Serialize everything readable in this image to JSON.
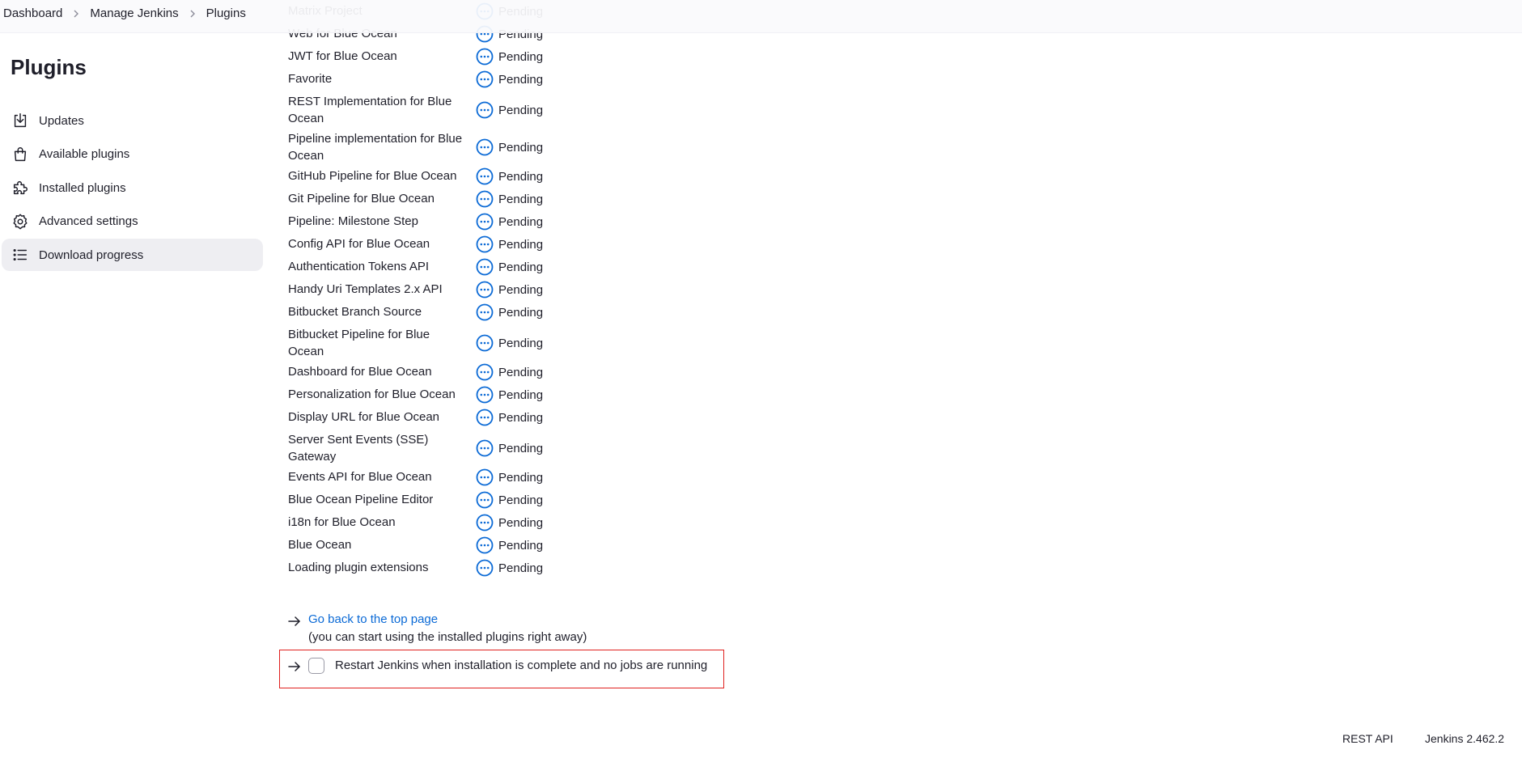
{
  "breadcrumb": {
    "items": [
      "Dashboard",
      "Manage Jenkins",
      "Plugins"
    ]
  },
  "sidebar": {
    "title": "Plugins",
    "items": [
      {
        "label": "Updates",
        "icon": "download-icon"
      },
      {
        "label": "Available plugins",
        "icon": "shopping-bag-icon"
      },
      {
        "label": "Installed plugins",
        "icon": "puzzle-icon"
      },
      {
        "label": "Advanced settings",
        "icon": "gear-icon"
      },
      {
        "label": "Download progress",
        "icon": "list-icon",
        "active": true
      }
    ]
  },
  "plugins": [
    {
      "name": "Matrix Project",
      "status": "Pending"
    },
    {
      "name": "Web for Blue Ocean",
      "status": "Pending"
    },
    {
      "name": "JWT for Blue Ocean",
      "status": "Pending"
    },
    {
      "name": "Favorite",
      "status": "Pending"
    },
    {
      "name": "REST Implementation for Blue Ocean",
      "status": "Pending"
    },
    {
      "name": "Pipeline implementation for Blue Ocean",
      "status": "Pending"
    },
    {
      "name": "GitHub Pipeline for Blue Ocean",
      "status": "Pending"
    },
    {
      "name": "Git Pipeline for Blue Ocean",
      "status": "Pending"
    },
    {
      "name": "Pipeline: Milestone Step",
      "status": "Pending"
    },
    {
      "name": "Config API for Blue Ocean",
      "status": "Pending"
    },
    {
      "name": "Authentication Tokens API",
      "status": "Pending"
    },
    {
      "name": "Handy Uri Templates 2.x API",
      "status": "Pending"
    },
    {
      "name": "Bitbucket Branch Source",
      "status": "Pending"
    },
    {
      "name": "Bitbucket Pipeline for Blue Ocean",
      "status": "Pending"
    },
    {
      "name": "Dashboard for Blue Ocean",
      "status": "Pending"
    },
    {
      "name": "Personalization for Blue Ocean",
      "status": "Pending"
    },
    {
      "name": "Display URL for Blue Ocean",
      "status": "Pending"
    },
    {
      "name": "Server Sent Events (SSE) Gateway",
      "status": "Pending"
    },
    {
      "name": "Events API for Blue Ocean",
      "status": "Pending"
    },
    {
      "name": "Blue Ocean Pipeline Editor",
      "status": "Pending"
    },
    {
      "name": "i18n for Blue Ocean",
      "status": "Pending"
    },
    {
      "name": "Blue Ocean",
      "status": "Pending"
    },
    {
      "name": "Loading plugin extensions",
      "status": "Pending"
    }
  ],
  "links": {
    "go_back": "Go back to the top page",
    "go_back_note": "(you can start using the installed plugins right away)",
    "restart_label": "Restart Jenkins when installation is complete and no jobs are running",
    "restart_checked": false
  },
  "footer": {
    "rest_api": "REST API",
    "version": "Jenkins 2.462.2"
  },
  "colors": {
    "accent": "#0b6ad6",
    "highlight_border": "#e0201e",
    "active_bg": "#eeeef2"
  }
}
